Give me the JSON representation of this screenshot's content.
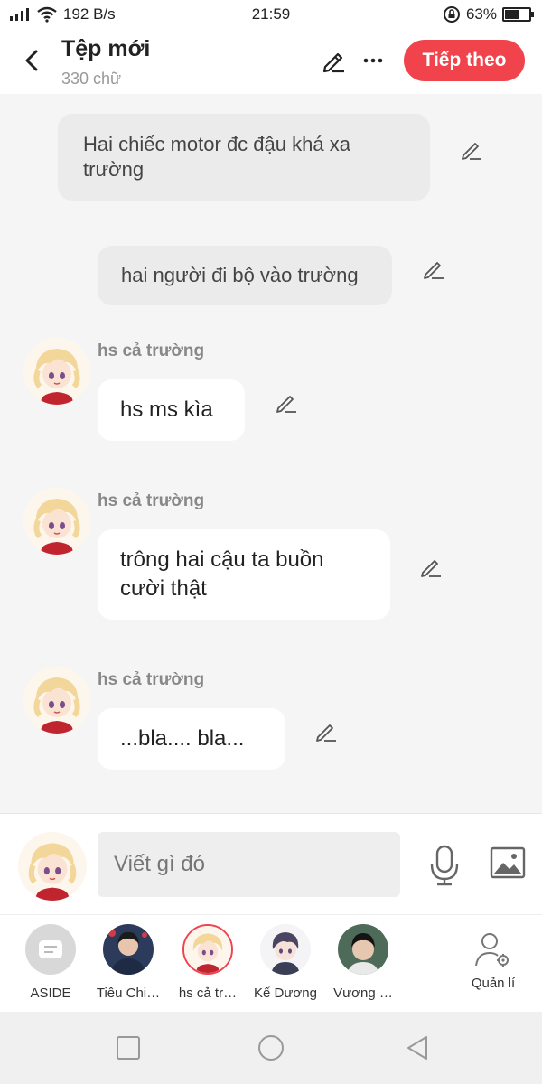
{
  "status_bar": {
    "network_speed": "192 B/s",
    "time": "21:59",
    "battery": "63%",
    "battery_level": 0.63
  },
  "header": {
    "title": "Tệp mới",
    "word_count": "330 chữ",
    "next_label": "Tiếp theo"
  },
  "messages": [
    {
      "type": "aside",
      "text_lines": [
        "Hai chiếc motor đc đậu khá xa",
        "trường"
      ]
    },
    {
      "type": "aside",
      "text_lines": [
        "hai người đi bộ vào trường"
      ]
    },
    {
      "type": "character",
      "sender": "hs cả trường",
      "text_lines": [
        "hs ms kìa"
      ]
    },
    {
      "type": "character",
      "sender": "hs cả trường",
      "text_lines": [
        "trông hai cậu ta buồn",
        "cười thật"
      ]
    },
    {
      "type": "character",
      "sender": "hs cả trường",
      "text_lines": [
        "...bla.... bla..."
      ]
    }
  ],
  "composer": {
    "placeholder": "Viết gì đó"
  },
  "characters": [
    {
      "label": "ASIDE",
      "icon": "aside-icon"
    },
    {
      "label": "Tiêu Chi…"
    },
    {
      "label": "hs cả tr…",
      "selected": true
    },
    {
      "label": "Kế Dương"
    },
    {
      "label": "Vương …"
    }
  ],
  "manage_label": "Quản lí",
  "colors": {
    "accent": "#f0434c",
    "aside_bubble": "#ebebeb",
    "message_bubble": "#ffffff",
    "background": "#f5f5f5"
  }
}
